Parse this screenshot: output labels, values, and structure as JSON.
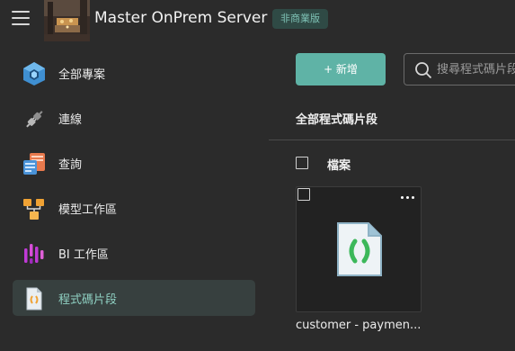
{
  "header": {
    "app_title": "Master OnPrem Server",
    "edition_badge": "非商業版"
  },
  "sidebar": {
    "items": [
      {
        "label": "全部專案",
        "icon": "all-projects-icon",
        "active": false
      },
      {
        "label": "連線",
        "icon": "connection-plug-icon",
        "active": false
      },
      {
        "label": "查詢",
        "icon": "query-icon",
        "active": false
      },
      {
        "label": "模型工作區",
        "icon": "model-workspace-icon",
        "active": false
      },
      {
        "label": "BI 工作區",
        "icon": "bi-workspace-icon",
        "active": false
      },
      {
        "label": "程式碼片段",
        "icon": "code-snippet-icon",
        "active": true
      }
    ]
  },
  "toolbar": {
    "add_label": "+ 新增",
    "search_placeholder": "搜尋程式碼片段"
  },
  "main": {
    "section_title": "全部程式碼片段",
    "column_header": "檔案",
    "files": [
      {
        "name": "customer - paymen..."
      }
    ]
  },
  "colors": {
    "accent": "#5fb3a6",
    "background": "#2b2b2b",
    "active_nav": "#37403f",
    "badge_bg": "#2f4a45",
    "badge_text": "#7ec2b5"
  }
}
